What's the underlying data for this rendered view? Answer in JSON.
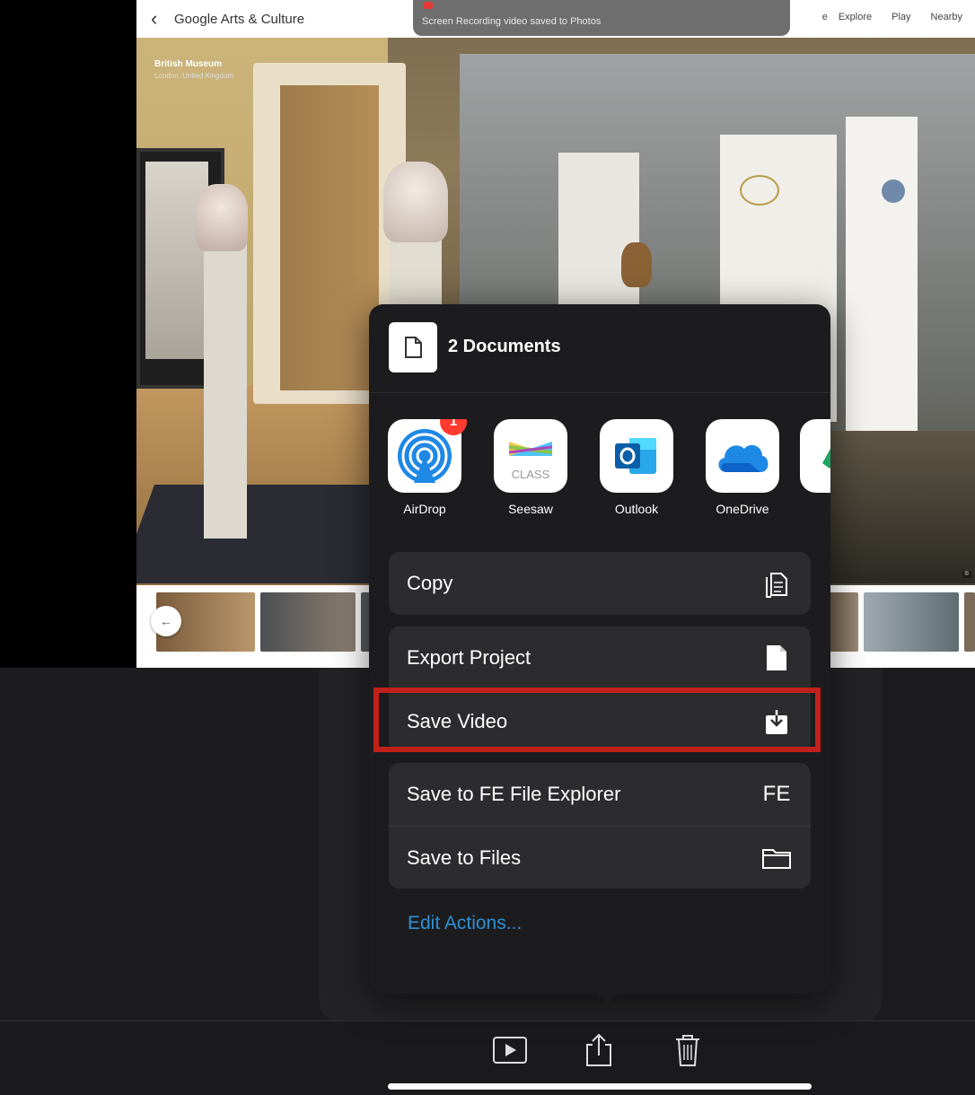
{
  "app_bar": {
    "brand": "Google Arts & Culture",
    "nav": [
      "e",
      "Explore",
      "Play",
      "Nearby"
    ]
  },
  "recording_toast": {
    "message": "Screen Recording video saved to Photos"
  },
  "location": {
    "title": "British Museum",
    "subtitle": "London, United Kingdom"
  },
  "share_sheet": {
    "title": "2 Documents",
    "apps": [
      {
        "label": "AirDrop",
        "badge": "1",
        "icon": "airdrop-icon"
      },
      {
        "label": "Seesaw",
        "icon": "seesaw-class-icon",
        "tile_text": "CLASS"
      },
      {
        "label": "Outlook",
        "icon": "outlook-icon"
      },
      {
        "label": "OneDrive",
        "icon": "onedrive-icon"
      }
    ],
    "actions_group1": [
      {
        "label": "Copy",
        "icon": "copy-icon"
      }
    ],
    "actions_group2": [
      {
        "label": "Export Project",
        "icon": "document-icon"
      },
      {
        "label": "Save Video",
        "icon": "save-video-icon"
      }
    ],
    "actions_group3": [
      {
        "label": "Save to FE File Explorer",
        "icon": "fe-icon",
        "icon_text": "FE"
      },
      {
        "label": "Save to Files",
        "icon": "folder-icon"
      }
    ],
    "edit_actions": "Edit Actions..."
  },
  "colors": {
    "sheet_bg": "#1c1c1e",
    "row_bg": "#2c2c2e",
    "highlight": "#c0211a",
    "link": "#2f8fd3",
    "badge": "#ff3b30"
  },
  "toolbar": [
    "play-icon",
    "share-icon",
    "trash-icon"
  ]
}
